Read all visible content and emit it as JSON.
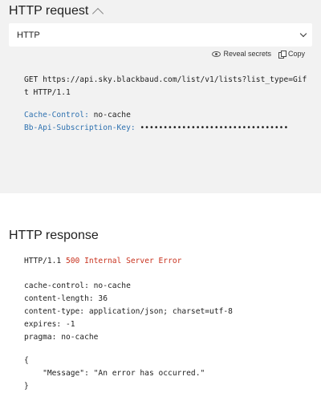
{
  "request": {
    "title": "HTTP request",
    "select_value": "HTTP",
    "reveal_label": "Reveal secrets",
    "copy_label": "Copy",
    "request_line_1": "GET https://api.sky.blackbaud.com/list/v1/lists?list_type=Gif",
    "request_line_2": "t HTTP/1.1",
    "headers": [
      {
        "key": "Cache-Control:",
        "value": "no-cache"
      },
      {
        "key": "Bb-Api-Subscription-Key:",
        "value": "••••••••••••••••••••••••••••••••"
      }
    ]
  },
  "response": {
    "title": "HTTP response",
    "status_proto": "HTTP/1.1",
    "status_text": "500 Internal Server Error",
    "headers": [
      "cache-control: no-cache",
      "content-length: 36",
      "content-type: application/json; charset=utf-8",
      "expires: -1",
      "pragma: no-cache"
    ],
    "body_open": "{",
    "body_line": "    \"Message\": \"An error has occurred.\"",
    "body_close": "}"
  },
  "colors": {
    "header_key": "#2f72b0",
    "error_status": "#c8321e",
    "request_background": "#f2f2f2"
  },
  "icons": [
    "chevron-up-icon",
    "chevron-down-icon",
    "eye-icon",
    "copy-icon"
  ]
}
